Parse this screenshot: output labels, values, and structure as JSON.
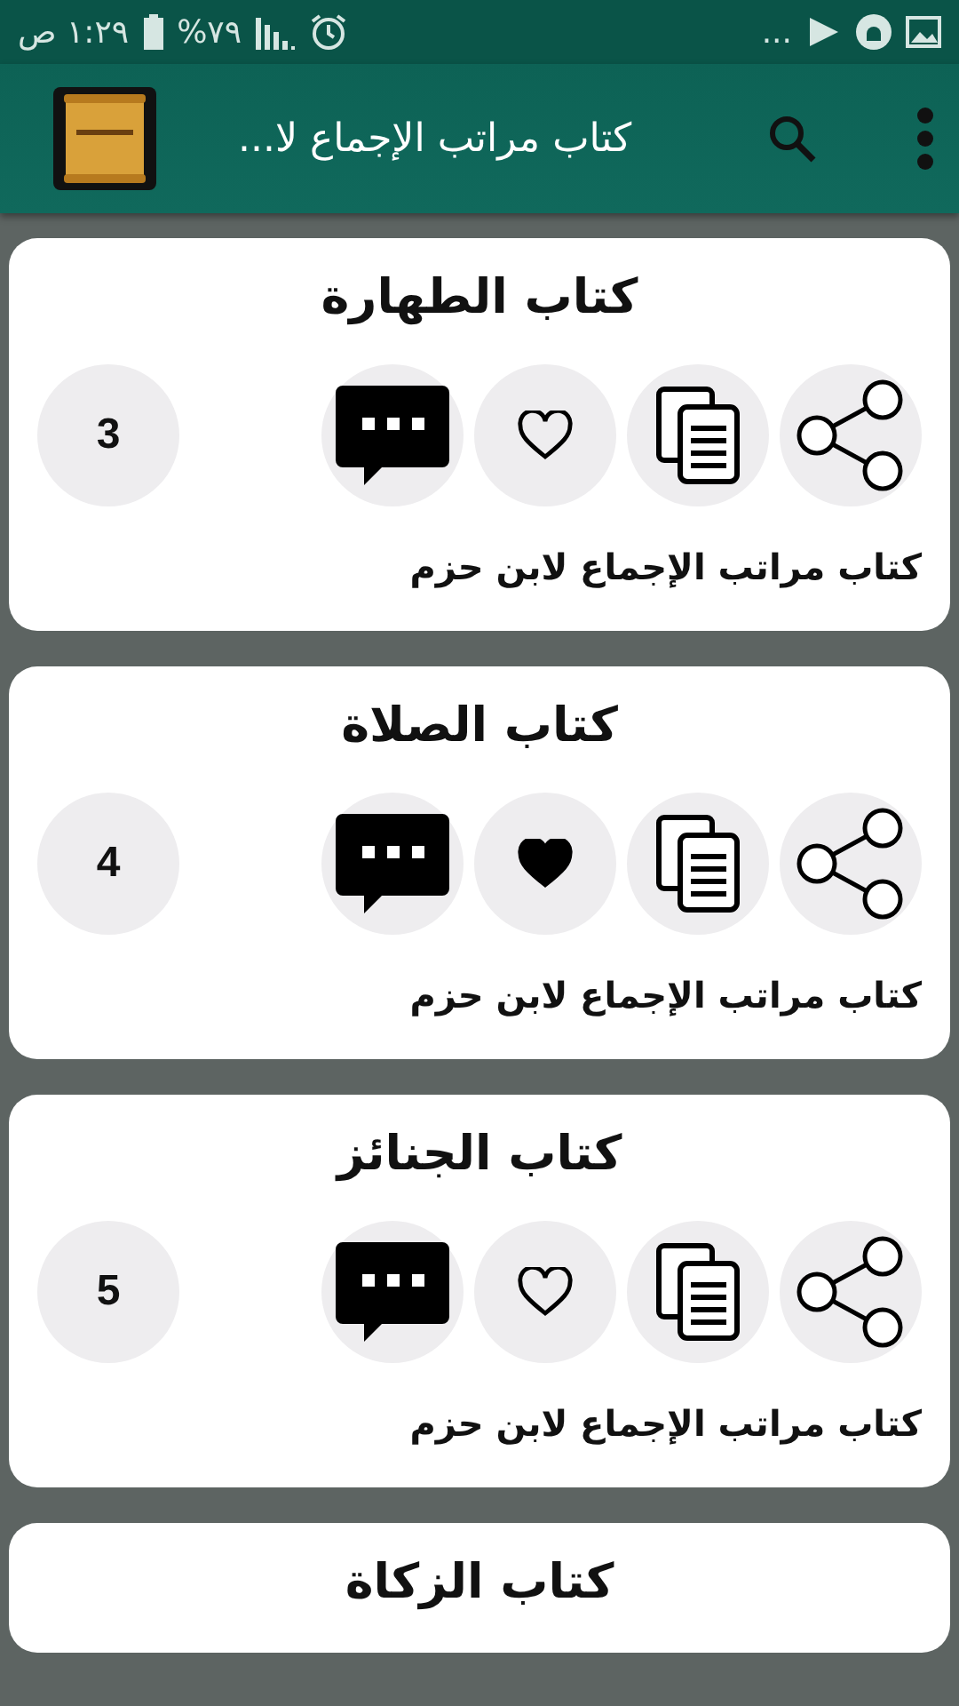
{
  "status_bar": {
    "time": "١:٢٩ ص",
    "battery": "٧٩%",
    "overflow": "..."
  },
  "app_bar": {
    "title": "كتاب مراتب الإجماع لا..."
  },
  "cards": [
    {
      "title": "كتاب الطهارة",
      "liked": false,
      "count": "3",
      "subtitle": "كتاب مراتب الإجماع لابن حزم"
    },
    {
      "title": "كتاب الصلاة",
      "liked": true,
      "count": "4",
      "subtitle": "كتاب مراتب الإجماع لابن حزم"
    },
    {
      "title": "كتاب الجنائز",
      "liked": false,
      "count": "5",
      "subtitle": "كتاب مراتب الإجماع لابن حزم"
    },
    {
      "title": "كتاب الزكاة"
    }
  ]
}
